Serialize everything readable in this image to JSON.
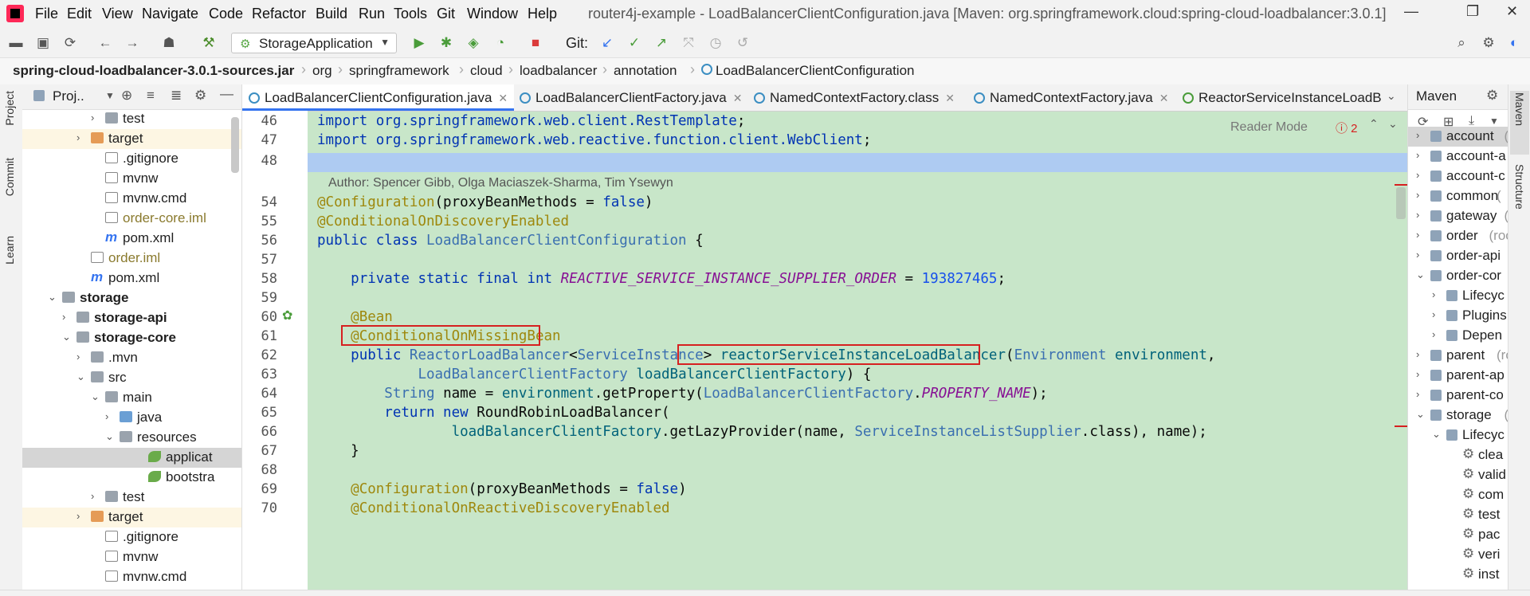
{
  "menubar": {
    "items": [
      "File",
      "Edit",
      "View",
      "Navigate",
      "Code",
      "Refactor",
      "Build",
      "Run",
      "Tools",
      "Git",
      "Window",
      "Help"
    ],
    "title": "router4j-example - LoadBalancerClientConfiguration.java [Maven: org.springframework.cloud:spring-cloud-loadbalancer:3.0.1]"
  },
  "toolbar": {
    "run_config": "StorageApplication",
    "git_label": "Git:"
  },
  "breadcrumb": [
    "spring-cloud-loadbalancer-3.0.1-sources.jar",
    "org",
    "springframework",
    "cloud",
    "loadbalancer",
    "annotation",
    "LoadBalancerClientConfiguration"
  ],
  "left_strip": [
    "Project",
    "Commit",
    "Learn"
  ],
  "project": {
    "title": "Proj..",
    "rows": [
      {
        "label": "test",
        "depth": 5,
        "arrow": "›",
        "icon": "folder"
      },
      {
        "label": "target",
        "depth": 4,
        "arrow": "›",
        "icon": "folder-o",
        "hl": true
      },
      {
        "label": ".gitignore",
        "depth": 5,
        "icon": "file"
      },
      {
        "label": "mvnw",
        "depth": 5,
        "icon": "file"
      },
      {
        "label": "mvnw.cmd",
        "depth": 5,
        "icon": "file"
      },
      {
        "label": "order-core.iml",
        "depth": 5,
        "icon": "file",
        "mod": true
      },
      {
        "label": "pom.xml",
        "depth": 5,
        "icon": "m"
      },
      {
        "label": "order.iml",
        "depth": 4,
        "icon": "file",
        "mod": true
      },
      {
        "label": "pom.xml",
        "depth": 4,
        "icon": "m"
      },
      {
        "label": "storage",
        "depth": 2,
        "arrow": "⌄",
        "icon": "folder",
        "bold": true
      },
      {
        "label": "storage-api",
        "depth": 3,
        "arrow": "›",
        "icon": "folder",
        "bold": true
      },
      {
        "label": "storage-core",
        "depth": 3,
        "arrow": "⌄",
        "icon": "folder",
        "bold": true
      },
      {
        "label": ".mvn",
        "depth": 4,
        "arrow": "›",
        "icon": "folder"
      },
      {
        "label": "src",
        "depth": 4,
        "arrow": "⌄",
        "icon": "folder"
      },
      {
        "label": "main",
        "depth": 5,
        "arrow": "⌄",
        "icon": "folder"
      },
      {
        "label": "java",
        "depth": 6,
        "arrow": "›",
        "icon": "folder-b"
      },
      {
        "label": "resources",
        "depth": 6,
        "arrow": "⌄",
        "icon": "folder"
      },
      {
        "label": "applicat",
        "depth": 8,
        "icon": "leaf",
        "sel": true
      },
      {
        "label": "bootstra",
        "depth": 8,
        "icon": "leaf"
      },
      {
        "label": "test",
        "depth": 5,
        "arrow": "›",
        "icon": "folder"
      },
      {
        "label": "target",
        "depth": 4,
        "arrow": "›",
        "icon": "folder-o",
        "hl": true
      },
      {
        "label": ".gitignore",
        "depth": 5,
        "icon": "file"
      },
      {
        "label": "mvnw",
        "depth": 5,
        "icon": "file"
      },
      {
        "label": "mvnw.cmd",
        "depth": 5,
        "icon": "file"
      }
    ]
  },
  "editor": {
    "tabs": [
      {
        "label": "LoadBalancerClientConfiguration.java",
        "active": true
      },
      {
        "label": "LoadBalancerClientFactory.java"
      },
      {
        "label": "NamedContextFactory.class"
      },
      {
        "label": "NamedContextFactory.java"
      },
      {
        "label": "ReactorServiceInstanceLoadBa"
      }
    ],
    "reader_mode": "Reader Mode",
    "problems": "2",
    "author": "Author: Spencer Gibb, Olga Maciaszek-Sharma, Tim Ysewyn",
    "lines": [
      "46",
      "47",
      "48",
      "54",
      "55",
      "56",
      "57",
      "58",
      "59",
      "60",
      "61",
      "62",
      "63",
      "64",
      "65",
      "66",
      "67",
      "68",
      "69",
      "70"
    ]
  },
  "maven": {
    "title": "Maven",
    "rows": [
      {
        "label": "account",
        "sub": "(",
        "depth": 0,
        "arrow": "›",
        "sel": true
      },
      {
        "label": "account-a",
        "depth": 0,
        "arrow": "›"
      },
      {
        "label": "account-c",
        "depth": 0,
        "arrow": "›"
      },
      {
        "label": "common",
        "sub": "(",
        "depth": 0,
        "arrow": "›"
      },
      {
        "label": "gateway",
        "sub": "(",
        "depth": 0,
        "arrow": "›"
      },
      {
        "label": "order",
        "sub": "(roo",
        "depth": 0,
        "arrow": "›"
      },
      {
        "label": "order-api",
        "depth": 0,
        "arrow": "›"
      },
      {
        "label": "order-cor",
        "depth": 0,
        "arrow": "⌄"
      },
      {
        "label": "Lifecyc",
        "depth": 1,
        "arrow": "›"
      },
      {
        "label": "Plugins",
        "depth": 1,
        "arrow": "›"
      },
      {
        "label": "Depen",
        "depth": 1,
        "arrow": "›"
      },
      {
        "label": "parent",
        "sub": "(ro",
        "depth": 0,
        "arrow": "›"
      },
      {
        "label": "parent-ap",
        "depth": 0,
        "arrow": "›"
      },
      {
        "label": "parent-co",
        "depth": 0,
        "arrow": "›"
      },
      {
        "label": "storage",
        "sub": "(r",
        "depth": 0,
        "arrow": "⌄"
      },
      {
        "label": "Lifecyc",
        "depth": 1,
        "arrow": "⌄"
      },
      {
        "label": "clea",
        "depth": 2
      },
      {
        "label": "valid",
        "depth": 2
      },
      {
        "label": "com",
        "depth": 2
      },
      {
        "label": "test",
        "depth": 2
      },
      {
        "label": "pac",
        "depth": 2
      },
      {
        "label": "veri",
        "depth": 2
      },
      {
        "label": "inst",
        "depth": 2
      }
    ]
  },
  "right_strip": [
    "Maven",
    "Structure"
  ]
}
